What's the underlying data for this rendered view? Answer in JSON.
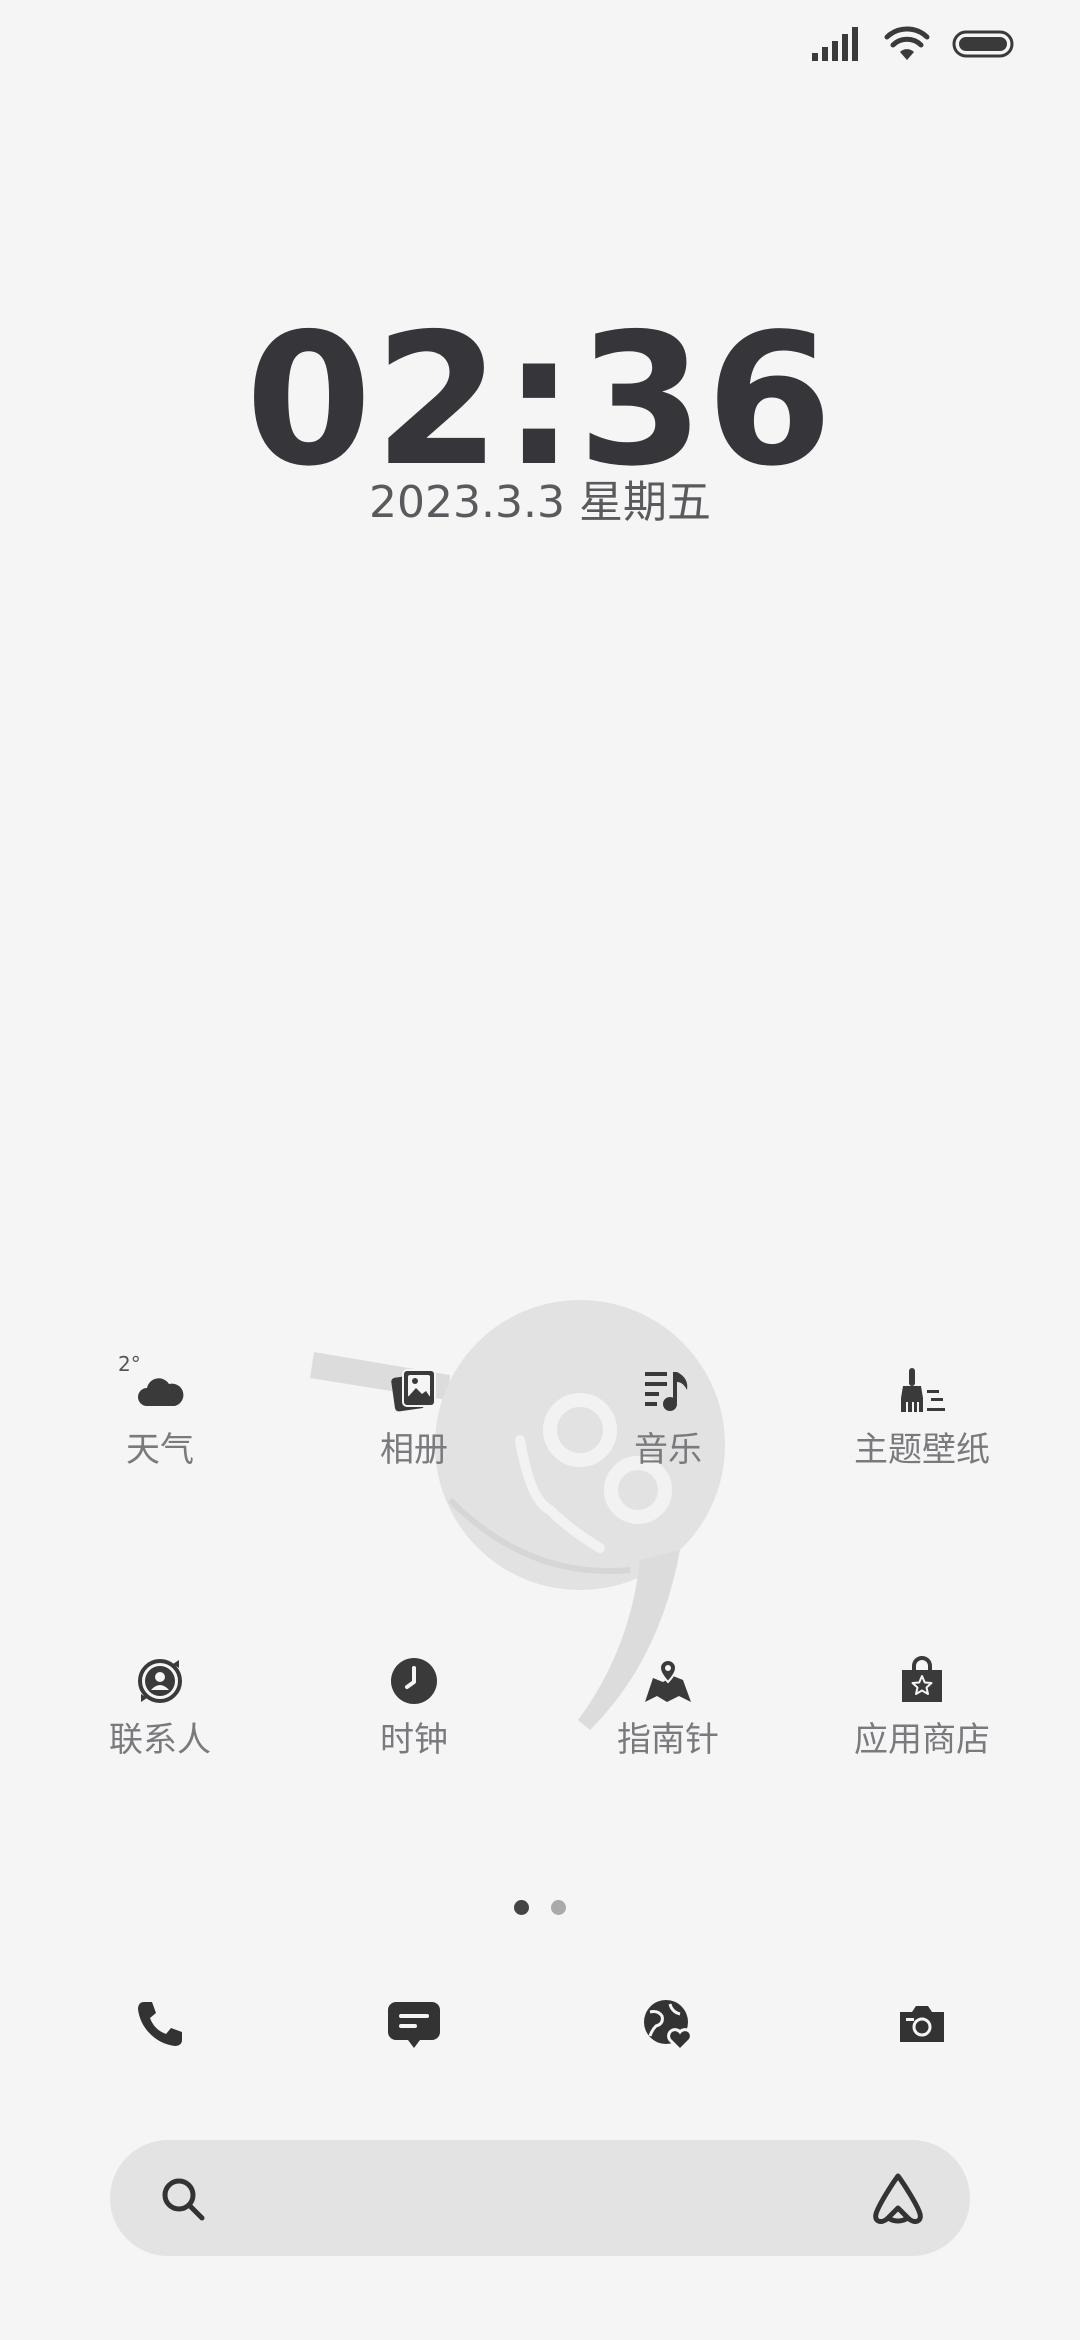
{
  "status_bar": {
    "icons": [
      "signal-icon",
      "wifi-icon",
      "battery-icon"
    ]
  },
  "lockscreen": {
    "time": "02:36",
    "date": "2023.3.3 星期五"
  },
  "widgets": {
    "weather_temp": "2°"
  },
  "apps": [
    {
      "label": "天气",
      "icon": "weather-cloud-icon"
    },
    {
      "label": "相册",
      "icon": "gallery-icon"
    },
    {
      "label": "音乐",
      "icon": "music-icon"
    },
    {
      "label": "主题壁纸",
      "icon": "theme-brush-icon"
    },
    {
      "label": "联系人",
      "icon": "contacts-icon"
    },
    {
      "label": "时钟",
      "icon": "clock-icon"
    },
    {
      "label": "指南针",
      "icon": "compass-map-icon"
    },
    {
      "label": "应用商店",
      "icon": "app-store-bag-icon"
    }
  ],
  "page_indicator": {
    "current_page": 1,
    "total_pages": 2
  },
  "dock": [
    "phone-icon",
    "messages-icon",
    "browser-icon",
    "camera-icon"
  ],
  "search": {
    "icons": [
      "search-icon",
      "assistant-icon"
    ]
  }
}
